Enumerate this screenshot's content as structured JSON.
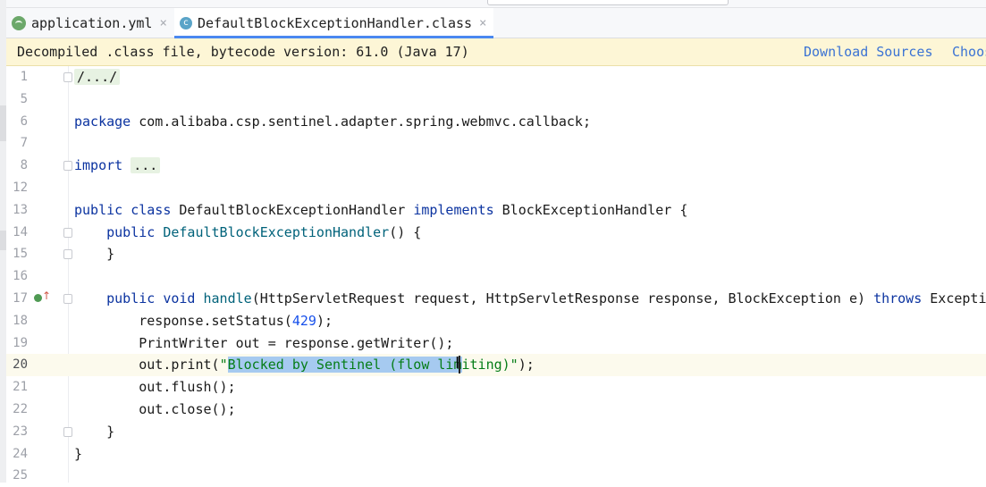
{
  "tabs": [
    {
      "label": "application.yml",
      "icon": "spring-leaf-icon",
      "close": "×",
      "active": false
    },
    {
      "label": "DefaultBlockExceptionHandler.class",
      "icon": "class-c-icon",
      "icon_glyph": "c",
      "close": "×",
      "active": true
    }
  ],
  "banner": {
    "message": "Decompiled .class file, bytecode version: 61.0 (Java 17)",
    "download_sources": "Download Sources",
    "choose_sources": "Choos"
  },
  "editor": {
    "current_line": "20",
    "lines": [
      {
        "num": "1",
        "parts": [
          {
            "t": "/.../",
            "c": "folded"
          }
        ]
      },
      {
        "num": "5",
        "parts": []
      },
      {
        "num": "6",
        "parts": [
          {
            "t": "package ",
            "c": "kw"
          },
          {
            "t": "com.alibaba.csp.sentinel.adapter.spring.webmvc.callback;",
            "c": ""
          }
        ]
      },
      {
        "num": "7",
        "parts": []
      },
      {
        "num": "8",
        "parts": [
          {
            "t": "import ",
            "c": "kw"
          },
          {
            "t": "...",
            "c": "folded"
          }
        ]
      },
      {
        "num": "12",
        "parts": []
      },
      {
        "num": "13",
        "parts": [
          {
            "t": "public class ",
            "c": "kw"
          },
          {
            "t": "DefaultBlockExceptionHandler ",
            "c": ""
          },
          {
            "t": "implements ",
            "c": "kw"
          },
          {
            "t": "BlockExceptionHandler {",
            "c": ""
          }
        ]
      },
      {
        "num": "14",
        "parts": [
          {
            "t": "    public ",
            "c": "kw"
          },
          {
            "t": "DefaultBlockExceptionHandler",
            "c": "fn"
          },
          {
            "t": "() {",
            "c": ""
          }
        ]
      },
      {
        "num": "15",
        "parts": [
          {
            "t": "    }",
            "c": ""
          }
        ]
      },
      {
        "num": "16",
        "parts": []
      },
      {
        "num": "17",
        "parts": [
          {
            "t": "    public void ",
            "c": "kw"
          },
          {
            "t": "handle",
            "c": "fn"
          },
          {
            "t": "(HttpServletRequest request, HttpServletResponse response, BlockException e) ",
            "c": ""
          },
          {
            "t": "throws ",
            "c": "kw"
          },
          {
            "t": "Exceptio",
            "c": ""
          }
        ]
      },
      {
        "num": "18",
        "parts": [
          {
            "t": "        response.setStatus(",
            "c": ""
          },
          {
            "t": "429",
            "c": "num"
          },
          {
            "t": ");",
            "c": ""
          }
        ]
      },
      {
        "num": "19",
        "parts": [
          {
            "t": "        PrintWriter out = response.getWriter();",
            "c": ""
          }
        ]
      },
      {
        "num": "20",
        "parts": [
          {
            "t": "        out.print(",
            "c": ""
          },
          {
            "t": "\"",
            "c": "str"
          },
          {
            "t": "Blocked by Sentinel (flow lim",
            "c": "str sel"
          },
          {
            "t": "iting)\"",
            "c": "str"
          },
          {
            "t": ");",
            "c": ""
          }
        ]
      },
      {
        "num": "21",
        "parts": [
          {
            "t": "        out.flush();",
            "c": ""
          }
        ]
      },
      {
        "num": "22",
        "parts": [
          {
            "t": "        out.close();",
            "c": ""
          }
        ]
      },
      {
        "num": "23",
        "parts": [
          {
            "t": "    }",
            "c": ""
          }
        ]
      },
      {
        "num": "24",
        "parts": [
          {
            "t": "}",
            "c": ""
          }
        ]
      },
      {
        "num": "25",
        "parts": []
      }
    ]
  }
}
